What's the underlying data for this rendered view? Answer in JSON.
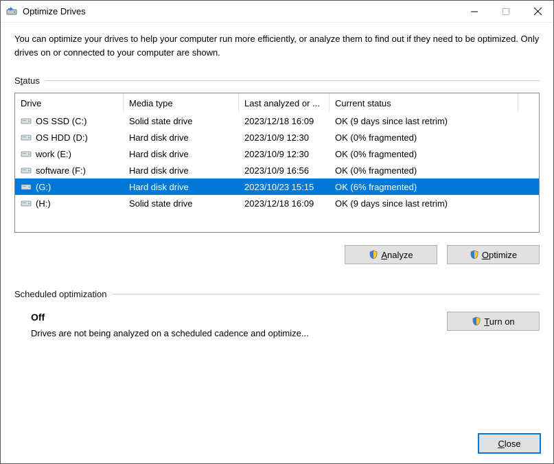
{
  "window": {
    "title": "Optimize Drives"
  },
  "intro": "You can optimize your drives to help your computer run more efficiently, or analyze them to find out if they need to be optimized. Only drives on or connected to your computer are shown.",
  "status_section_label": "Status",
  "columns": {
    "drive": "Drive",
    "media": "Media type",
    "last": "Last analyzed or ...",
    "status": "Current status"
  },
  "drives": [
    {
      "name": "OS SSD (C:)",
      "media": "Solid state drive",
      "last": "2023/12/18 16:09",
      "status": "OK (9 days since last retrim)",
      "icon": "ssd",
      "selected": false
    },
    {
      "name": "OS HDD (D:)",
      "media": "Hard disk drive",
      "last": "2023/10/9 12:30",
      "status": "OK (0% fragmented)",
      "icon": "hdd",
      "selected": false
    },
    {
      "name": "work (E:)",
      "media": "Hard disk drive",
      "last": "2023/10/9 12:30",
      "status": "OK (0% fragmented)",
      "icon": "hdd",
      "selected": false
    },
    {
      "name": "software (F:)",
      "media": "Hard disk drive",
      "last": "2023/10/9 16:56",
      "status": "OK (0% fragmented)",
      "icon": "hdd",
      "selected": false
    },
    {
      "name": "(G:)",
      "media": "Hard disk drive",
      "last": "2023/10/23 15:15",
      "status": "OK (6% fragmented)",
      "icon": "hdd",
      "selected": true
    },
    {
      "name": "(H:)",
      "media": "Solid state drive",
      "last": "2023/12/18 16:09",
      "status": "OK (9 days since last retrim)",
      "icon": "hdd",
      "selected": false
    }
  ],
  "buttons": {
    "analyze": "Analyze",
    "optimize": "Optimize",
    "turn_on": "Turn on",
    "close": "Close"
  },
  "scheduled": {
    "section_label": "Scheduled optimization",
    "status": "Off",
    "description": "Drives are not being analyzed on a scheduled cadence and optimize..."
  }
}
